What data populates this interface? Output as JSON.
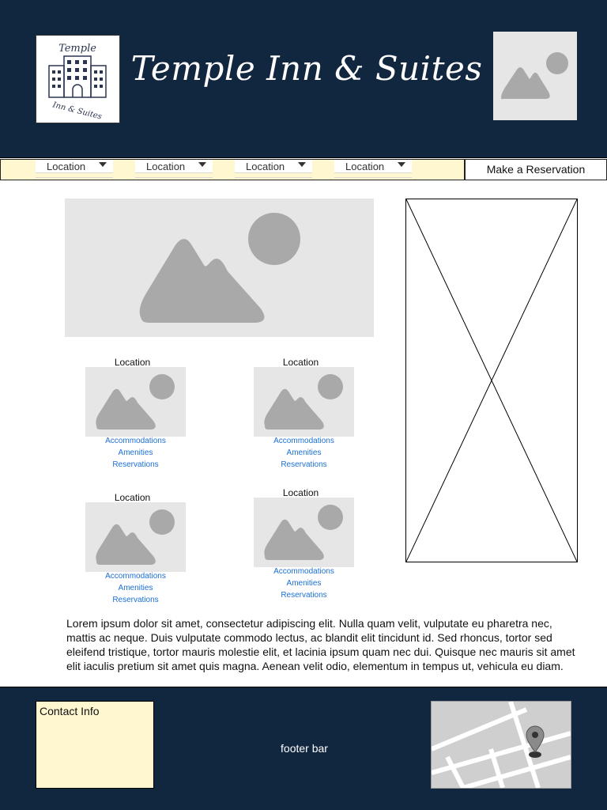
{
  "header": {
    "title": "Temple Inn & Suites",
    "logo_icon": "hotel-building-icon",
    "logo_text_top": "Temple",
    "logo_text_bottom": "Inn & Suites",
    "image_icon": "image-placeholder-icon"
  },
  "nav": {
    "items": [
      {
        "label": "Location"
      },
      {
        "label": "Location"
      },
      {
        "label": "Location"
      },
      {
        "label": "Location"
      }
    ],
    "reservation_label": "Make a Reservation"
  },
  "main": {
    "locations": [
      {
        "title": "Location",
        "links": [
          "Accommodations",
          "Amenities",
          "Reservations"
        ]
      },
      {
        "title": "Location",
        "links": [
          "Accommodations",
          "Amenities",
          "Reservations"
        ]
      },
      {
        "title": "Location",
        "links": [
          "Accommodations",
          "Amenities",
          "Reservations"
        ]
      },
      {
        "title": "Location",
        "links": [
          "Accommodations",
          "Amenities",
          "Reservations"
        ]
      }
    ],
    "body_text": "Lorem ipsum dolor sit amet, consectetur adipiscing elit. Nulla quam velit, vulputate eu pharetra nec, mattis ac neque. Duis vulputate commodo lectus, ac blandit elit tincidunt id. Sed rhoncus, tortor sed eleifend tristique, tortor mauris molestie elit, et lacinia ipsum quam nec dui. Quisque nec mauris sit amet elit iaculis pretium sit amet quis magna. Aenean velit odio, elementum in tempus ut, vehicula eu diam."
  },
  "footer": {
    "contact_label": "Contact Info",
    "footer_label": "footer bar",
    "map_icon": "map-pin-icon"
  },
  "colors": {
    "header_bg": "#11263f",
    "nav_bg": "#fff7cf",
    "link": "#1b6fd6",
    "placeholder": "#e6e6e6"
  }
}
